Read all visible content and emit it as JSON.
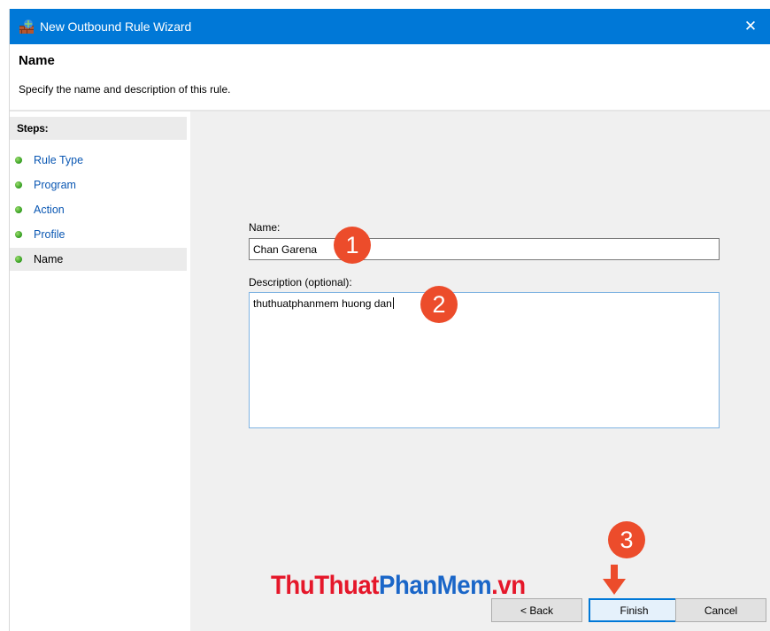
{
  "window": {
    "title": "New Outbound Rule Wizard",
    "close_glyph": "✕",
    "accent_color": "#0078d7"
  },
  "header": {
    "title": "Name",
    "subtitle": "Specify the name and description of this rule."
  },
  "steps": {
    "title": "Steps:",
    "items": [
      {
        "label": "Rule Type"
      },
      {
        "label": "Program"
      },
      {
        "label": "Action"
      },
      {
        "label": "Profile"
      },
      {
        "label": "Name"
      }
    ],
    "current_index": 4
  },
  "form": {
    "name_label": "Name:",
    "name_value": "Chan Garena",
    "description_label": "Description (optional):",
    "description_value": "thuthuatphanmem huong dan"
  },
  "buttons": {
    "back": "< Back",
    "finish": "Finish",
    "cancel": "Cancel"
  },
  "watermark": {
    "part1": "ThuThuat",
    "part2": "PhanMem",
    "part3": ".vn"
  },
  "annotations": {
    "badge1": "1",
    "badge2": "2",
    "badge3": "3",
    "badge_color": "#ec4c2b"
  }
}
